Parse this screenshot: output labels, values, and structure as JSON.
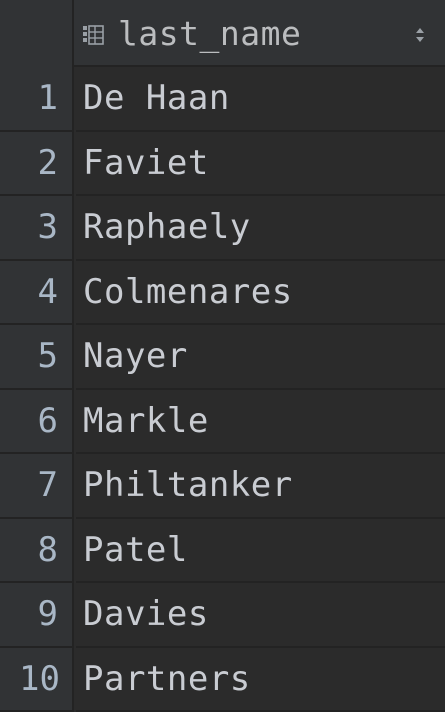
{
  "column": {
    "title": "last_name",
    "icon": "column-table-icon",
    "sort_icon": "sort-updown-icon"
  },
  "rows": [
    {
      "num": "1",
      "value": "De Haan"
    },
    {
      "num": "2",
      "value": "Faviet"
    },
    {
      "num": "3",
      "value": "Raphaely"
    },
    {
      "num": "4",
      "value": "Colmenares"
    },
    {
      "num": "5",
      "value": "Nayer"
    },
    {
      "num": "6",
      "value": "Markle"
    },
    {
      "num": "7",
      "value": "Philtanker"
    },
    {
      "num": "8",
      "value": "Patel"
    },
    {
      "num": "9",
      "value": "Davies"
    },
    {
      "num": "10",
      "value": "Partners"
    }
  ],
  "colors": {
    "background": "#2b2b2b",
    "gutter": "#313335",
    "text": "#c9ccd2",
    "grid_line": "#232323"
  }
}
